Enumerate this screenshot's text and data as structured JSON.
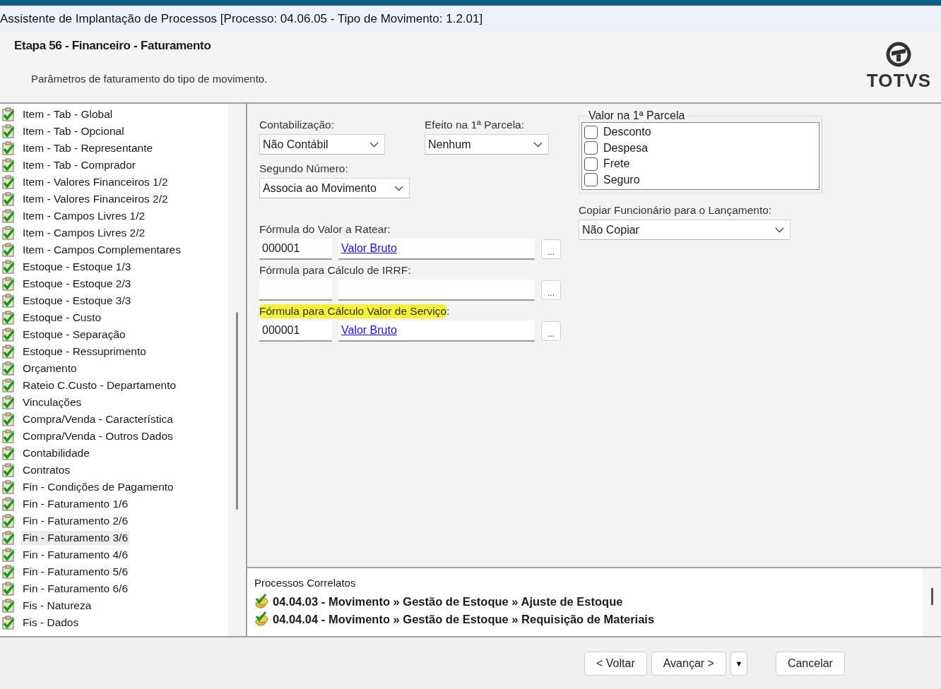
{
  "window": {
    "title": "Assistente de Implantação de Processos [Processo: 04.06.05 - Tipo de Movimento: 1.2.01]"
  },
  "header": {
    "step_title": "Etapa 56 - Financeiro - Faturamento",
    "description": "Parâmetros de faturamento do tipo de movimento.",
    "logo_text": "TOTVS"
  },
  "sidebar": {
    "items": [
      {
        "label": "Item - Tab - Global",
        "selected": false
      },
      {
        "label": "Item - Tab - Opcional",
        "selected": false
      },
      {
        "label": "Item - Tab - Representante",
        "selected": false
      },
      {
        "label": "Item - Tab - Comprador",
        "selected": false
      },
      {
        "label": "Item - Valores Financeiros 1/2",
        "selected": false
      },
      {
        "label": "Item - Valores Financeiros 2/2",
        "selected": false
      },
      {
        "label": "Item - Campos Livres 1/2",
        "selected": false
      },
      {
        "label": "Item - Campos Livres 2/2",
        "selected": false
      },
      {
        "label": "Item - Campos Complementares",
        "selected": false
      },
      {
        "label": "Estoque - Estoque 1/3",
        "selected": false
      },
      {
        "label": "Estoque - Estoque 2/3",
        "selected": false
      },
      {
        "label": "Estoque - Estoque 3/3",
        "selected": false
      },
      {
        "label": "Estoque - Custo",
        "selected": false
      },
      {
        "label": "Estoque - Separação",
        "selected": false
      },
      {
        "label": "Estoque - Ressuprimento",
        "selected": false
      },
      {
        "label": "Orçamento",
        "selected": false
      },
      {
        "label": "Rateio C.Custo - Departamento",
        "selected": false
      },
      {
        "label": "Vinculações",
        "selected": false
      },
      {
        "label": "Compra/Venda - Característica",
        "selected": false
      },
      {
        "label": "Compra/Venda - Outros Dados",
        "selected": false
      },
      {
        "label": "Contabilidade",
        "selected": false
      },
      {
        "label": "Contratos",
        "selected": false
      },
      {
        "label": "Fin - Condições de Pagamento",
        "selected": false
      },
      {
        "label": "Fin - Faturamento 1/6",
        "selected": false
      },
      {
        "label": "Fin - Faturamento 2/6",
        "selected": false
      },
      {
        "label": "Fin - Faturamento 3/6",
        "selected": true
      },
      {
        "label": "Fin - Faturamento 4/6",
        "selected": false
      },
      {
        "label": "Fin - Faturamento 5/6",
        "selected": false
      },
      {
        "label": "Fin - Faturamento 6/6",
        "selected": false
      },
      {
        "label": "Fis - Natureza",
        "selected": false
      },
      {
        "label": "Fis - Dados",
        "selected": false
      }
    ]
  },
  "form": {
    "dropdowns_top": [
      {
        "label": "Contabilização:",
        "value": "Não Contábil"
      },
      {
        "label": "Efeito na 1ª Parcela:",
        "value": "Nenhum"
      }
    ],
    "second_number": {
      "label": "Segundo Número:",
      "value": "Associa ao Movimento"
    },
    "formulas": [
      {
        "label": "Fórmula do Valor a Ratear:",
        "highlighted": false,
        "code": "000001",
        "link": "Valor Bruto",
        "button": "..."
      },
      {
        "label": "Fórmula para Cálculo de IRRF:",
        "highlighted": false,
        "button": "..."
      },
      {
        "label": "Fórmula para Cálculo Valor de Serviço",
        "label_suffix": ":",
        "highlighted": true,
        "code": "000001",
        "link": "Valor Bruto",
        "button": "..."
      }
    ],
    "first_installment_group": {
      "title": "Valor na 1ª Parcela",
      "options": [
        {
          "label": "Desconto",
          "checked": false
        },
        {
          "label": "Despesa",
          "checked": false
        },
        {
          "label": "Frete",
          "checked": false
        },
        {
          "label": "Seguro",
          "checked": false
        }
      ]
    },
    "copy_employee": {
      "label": "Copiar Funcionário para o Lançamento:",
      "value": "Não Copiar"
    }
  },
  "related_processes": {
    "title": "Processos Correlatos",
    "items": [
      "04.04.03 - Movimento » Gestão de Estoque » Ajuste de Estoque",
      "04.04.04 - Movimento » Gestão de Estoque » Requisição de Materiais"
    ]
  },
  "buttons": [
    {
      "label": "< Voltar",
      "kind": "button"
    },
    {
      "label": "Avançar >",
      "kind": "button"
    },
    {
      "label": "▼",
      "kind": "split"
    },
    {
      "label": "Cancelar",
      "kind": "button"
    }
  ]
}
